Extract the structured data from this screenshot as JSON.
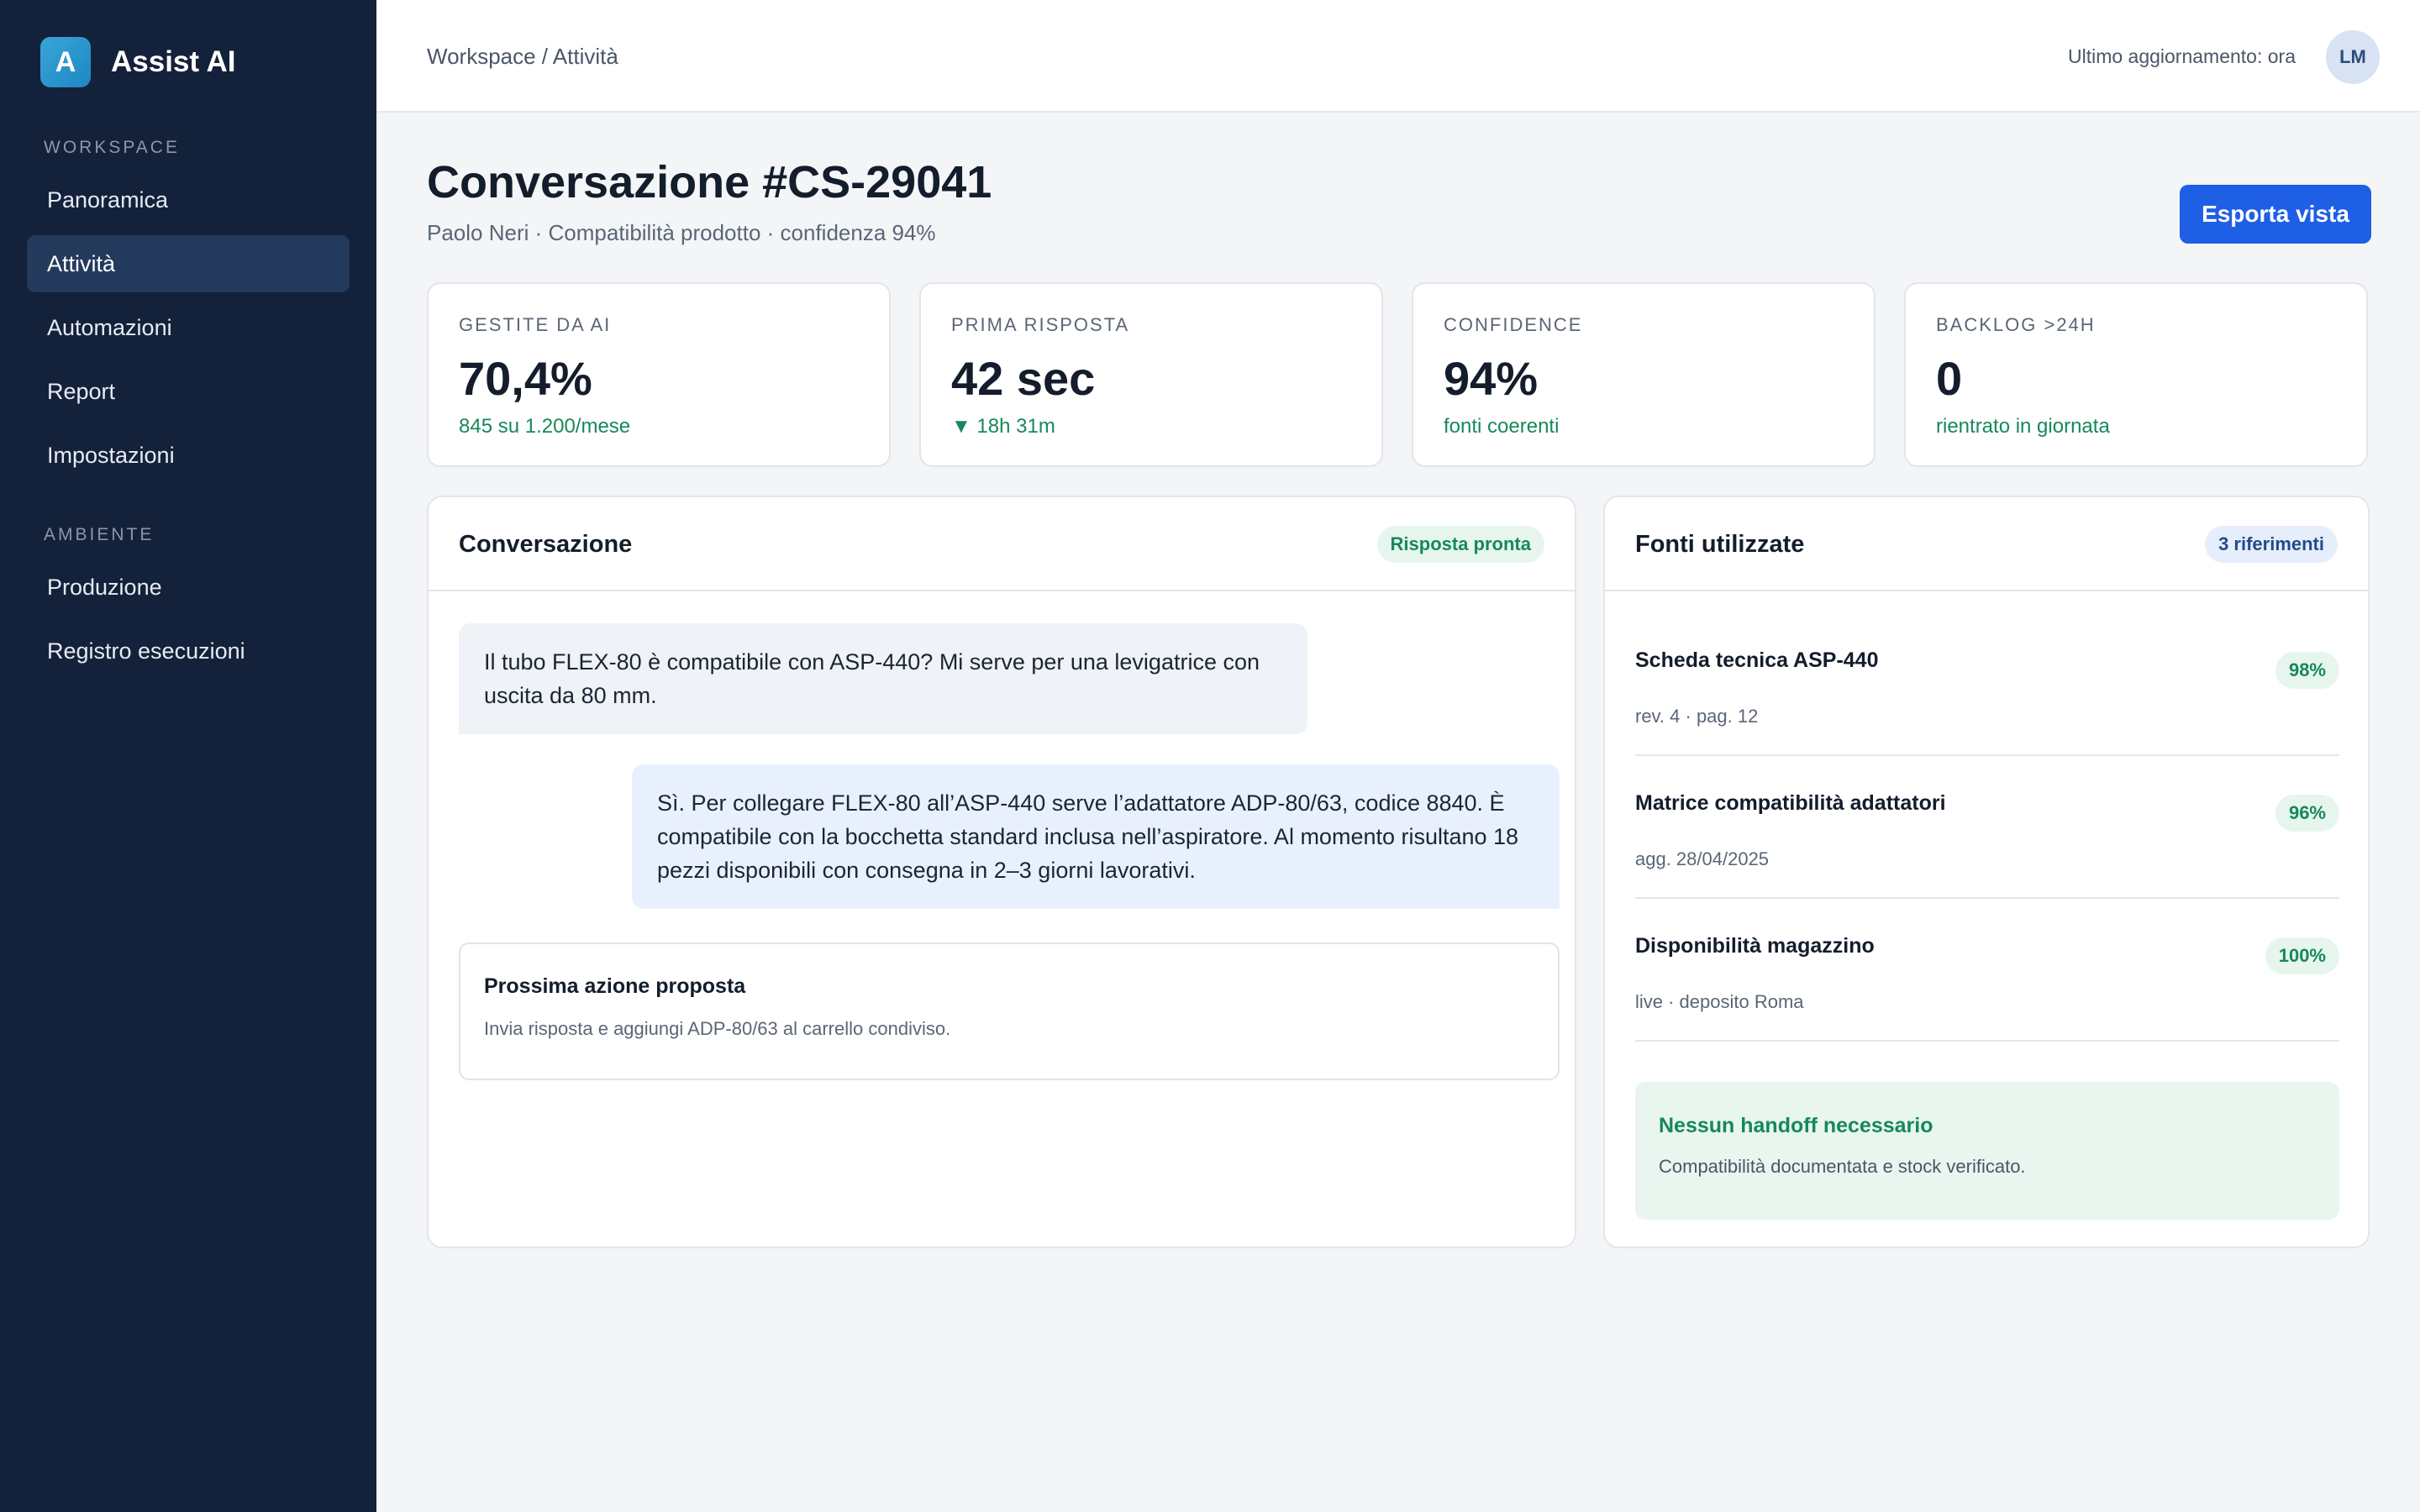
{
  "sidebar": {
    "brand": {
      "logo_letter": "A",
      "name": "Assist AI"
    },
    "sections": [
      {
        "label": "WORKSPACE",
        "items": [
          "Panoramica",
          "Attività",
          "Automazioni",
          "Report",
          "Impostazioni"
        ]
      },
      {
        "label": "AMBIENTE",
        "items": [
          "Produzione",
          "Registro esecuzioni"
        ]
      }
    ],
    "active_item": "Attività"
  },
  "topbar": {
    "breadcrumb": "Workspace / Attività",
    "last_update": "Ultimo aggiornamento: ora",
    "avatar_initials": "LM"
  },
  "header": {
    "title": "Conversazione #CS-29041",
    "subtitle": "Paolo Neri · Compatibilità prodotto · confidenza 94%",
    "export_label": "Esporta vista"
  },
  "kpis": [
    {
      "label": "GESTITE DA AI",
      "value": "70,4%",
      "sub": "845 su 1.200/mese"
    },
    {
      "label": "PRIMA RISPOSTA",
      "value": "42 sec",
      "sub": "▼ 18h 31m"
    },
    {
      "label": "CONFIDENCE",
      "value": "94%",
      "sub": "fonti coerenti"
    },
    {
      "label": "BACKLOG >24H",
      "value": "0",
      "sub": "rientrato in giornata"
    }
  ],
  "conversation": {
    "title": "Conversazione",
    "status": "Risposta pronta",
    "user_message": "Il tubo FLEX-80 è compatibile con ASP-440? Mi serve per una levigatrice con uscita da 80 mm.",
    "bot_message": "Sì. Per collegare FLEX-80 all’ASP-440 serve l’adattatore ADP-80/63, codice 8840. È compatibile con la bocchetta standard inclusa nell’aspiratore. Al momento risultano 18 pezzi disponibili con consegna in 2–3 giorni lavorativi.",
    "next_action": {
      "title": "Prossima azione proposta",
      "text": "Invia risposta e aggiungi ADP-80/63 al carrello condiviso."
    }
  },
  "sources": {
    "title": "Fonti utilizzate",
    "count_label": "3 riferimenti",
    "items": [
      {
        "title": "Scheda tecnica ASP-440",
        "meta": "rev. 4 · pag. 12",
        "score": "98%"
      },
      {
        "title": "Matrice compatibilità adattatori",
        "meta": "agg. 28/04/2025",
        "score": "96%"
      },
      {
        "title": "Disponibilità magazzino",
        "meta": "live · deposito Roma",
        "score": "100%"
      }
    ],
    "handoff": {
      "title": "Nessun handoff necessario",
      "text": "Compatibilità documentata e stock verificato."
    }
  },
  "colors": {
    "sidebar_bg": "#14213a",
    "primary": "#1f5fe6",
    "success": "#17885a",
    "page_bg": "#f3f5f7"
  }
}
